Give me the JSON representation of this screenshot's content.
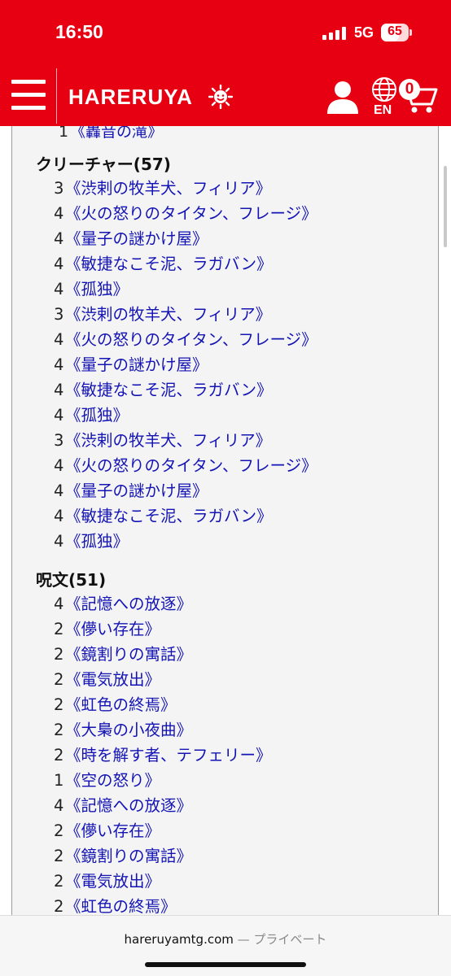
{
  "status_bar": {
    "time": "16:50",
    "network": "5G",
    "battery": 65
  },
  "header": {
    "logo": "HARERUYA",
    "language": "EN",
    "cart_count": "0"
  },
  "content": {
    "cut_item": {
      "qty": "1",
      "name": "《轟音の滝》"
    },
    "sections": [
      {
        "title": "クリーチャー(57)",
        "cards": [
          {
            "qty": "3",
            "name": "《渋剌の牧羊犬、フィリア》"
          },
          {
            "qty": "4",
            "name": "《火の怒りのタイタン、フレージ》"
          },
          {
            "qty": "4",
            "name": "《量子の謎かけ屋》"
          },
          {
            "qty": "4",
            "name": "《敏捷なこそ泥、ラガバン》"
          },
          {
            "qty": "4",
            "name": "《孤独》"
          },
          {
            "qty": "3",
            "name": "《渋剌の牧羊犬、フィリア》"
          },
          {
            "qty": "4",
            "name": "《火の怒りのタイタン、フレージ》"
          },
          {
            "qty": "4",
            "name": "《量子の謎かけ屋》"
          },
          {
            "qty": "4",
            "name": "《敏捷なこそ泥、ラガバン》"
          },
          {
            "qty": "4",
            "name": "《孤独》"
          },
          {
            "qty": "3",
            "name": "《渋剌の牧羊犬、フィリア》"
          },
          {
            "qty": "4",
            "name": "《火の怒りのタイタン、フレージ》"
          },
          {
            "qty": "4",
            "name": "《量子の謎かけ屋》"
          },
          {
            "qty": "4",
            "name": "《敏捷なこそ泥、ラガバン》"
          },
          {
            "qty": "4",
            "name": "《孤独》"
          }
        ]
      },
      {
        "title": "呪文(51)",
        "cards": [
          {
            "qty": "4",
            "name": "《記憶への放逐》"
          },
          {
            "qty": "2",
            "name": "《儚い存在》"
          },
          {
            "qty": "2",
            "name": "《鏡割りの寓話》"
          },
          {
            "qty": "2",
            "name": "《電気放出》"
          },
          {
            "qty": "2",
            "name": "《虹色の終焉》"
          },
          {
            "qty": "2",
            "name": "《大梟の小夜曲》"
          },
          {
            "qty": "2",
            "name": "《時を解す者、テフェリー》"
          },
          {
            "qty": "1",
            "name": "《空の怒り》"
          },
          {
            "qty": "4",
            "name": "《記憶への放逐》"
          },
          {
            "qty": "2",
            "name": "《儚い存在》"
          },
          {
            "qty": "2",
            "name": "《鏡割りの寓話》"
          },
          {
            "qty": "2",
            "name": "《電気放出》"
          },
          {
            "qty": "2",
            "name": "《虹色の終焉》"
          }
        ]
      }
    ]
  },
  "browser": {
    "domain": "hareruyamtg.com",
    "mode": "— プライベート"
  },
  "colors": {
    "brand_red": "#e60012",
    "link_blue": "#1414b4"
  }
}
